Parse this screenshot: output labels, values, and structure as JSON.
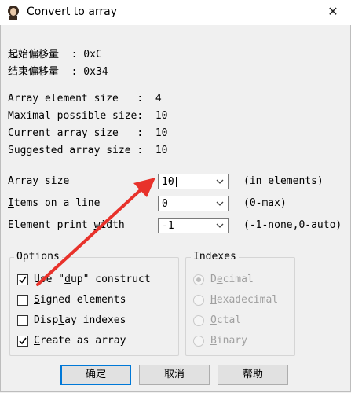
{
  "window": {
    "title": "Convert to array",
    "close_glyph": "✕"
  },
  "offsets": {
    "start_label": "起始偏移量  : 0xC",
    "end_label": "结束偏移量  : 0x34"
  },
  "info": {
    "element_size": "Array element size   :  4",
    "maximal_size": "Maximal possible size:  10",
    "current_size": "Current array size   :  10",
    "suggested_size": "Suggested array size :  10"
  },
  "fields": {
    "array_size": {
      "label_pre": "",
      "label_ul": "A",
      "label_post": "rray size",
      "value": "10",
      "hint": "(in elements)"
    },
    "items_on_line": {
      "label_pre": "",
      "label_ul": "I",
      "label_post": "tems on a line",
      "value": "0",
      "hint": "(0-max)"
    },
    "print_width": {
      "label_pre": "Element print ",
      "label_ul": "w",
      "label_post": "idth",
      "value": "-1",
      "hint": "(-1-none,0-auto)"
    }
  },
  "options": {
    "title": "Options",
    "items": [
      {
        "pre": "Use \"",
        "ul": "d",
        "post": "up\" construct",
        "checked": true
      },
      {
        "pre": "",
        "ul": "S",
        "post": "igned elements",
        "checked": false
      },
      {
        "pre": "Disp",
        "ul": "l",
        "post": "ay indexes",
        "checked": false
      },
      {
        "pre": "",
        "ul": "C",
        "post": "reate as array",
        "checked": true
      }
    ]
  },
  "indexes": {
    "title": "Indexes",
    "items": [
      {
        "pre": "D",
        "ul": "e",
        "post": "cimal",
        "selected": true
      },
      {
        "pre": "",
        "ul": "H",
        "post": "exadecimal",
        "selected": false
      },
      {
        "pre": "",
        "ul": "O",
        "post": "ctal",
        "selected": false
      },
      {
        "pre": "",
        "ul": "B",
        "post": "inary",
        "selected": false
      }
    ]
  },
  "buttons": {
    "ok": "确定",
    "cancel": "取消",
    "help": "帮助"
  },
  "colors": {
    "annotation_arrow": "#e8322b",
    "default_button_border": "#0078d7"
  }
}
